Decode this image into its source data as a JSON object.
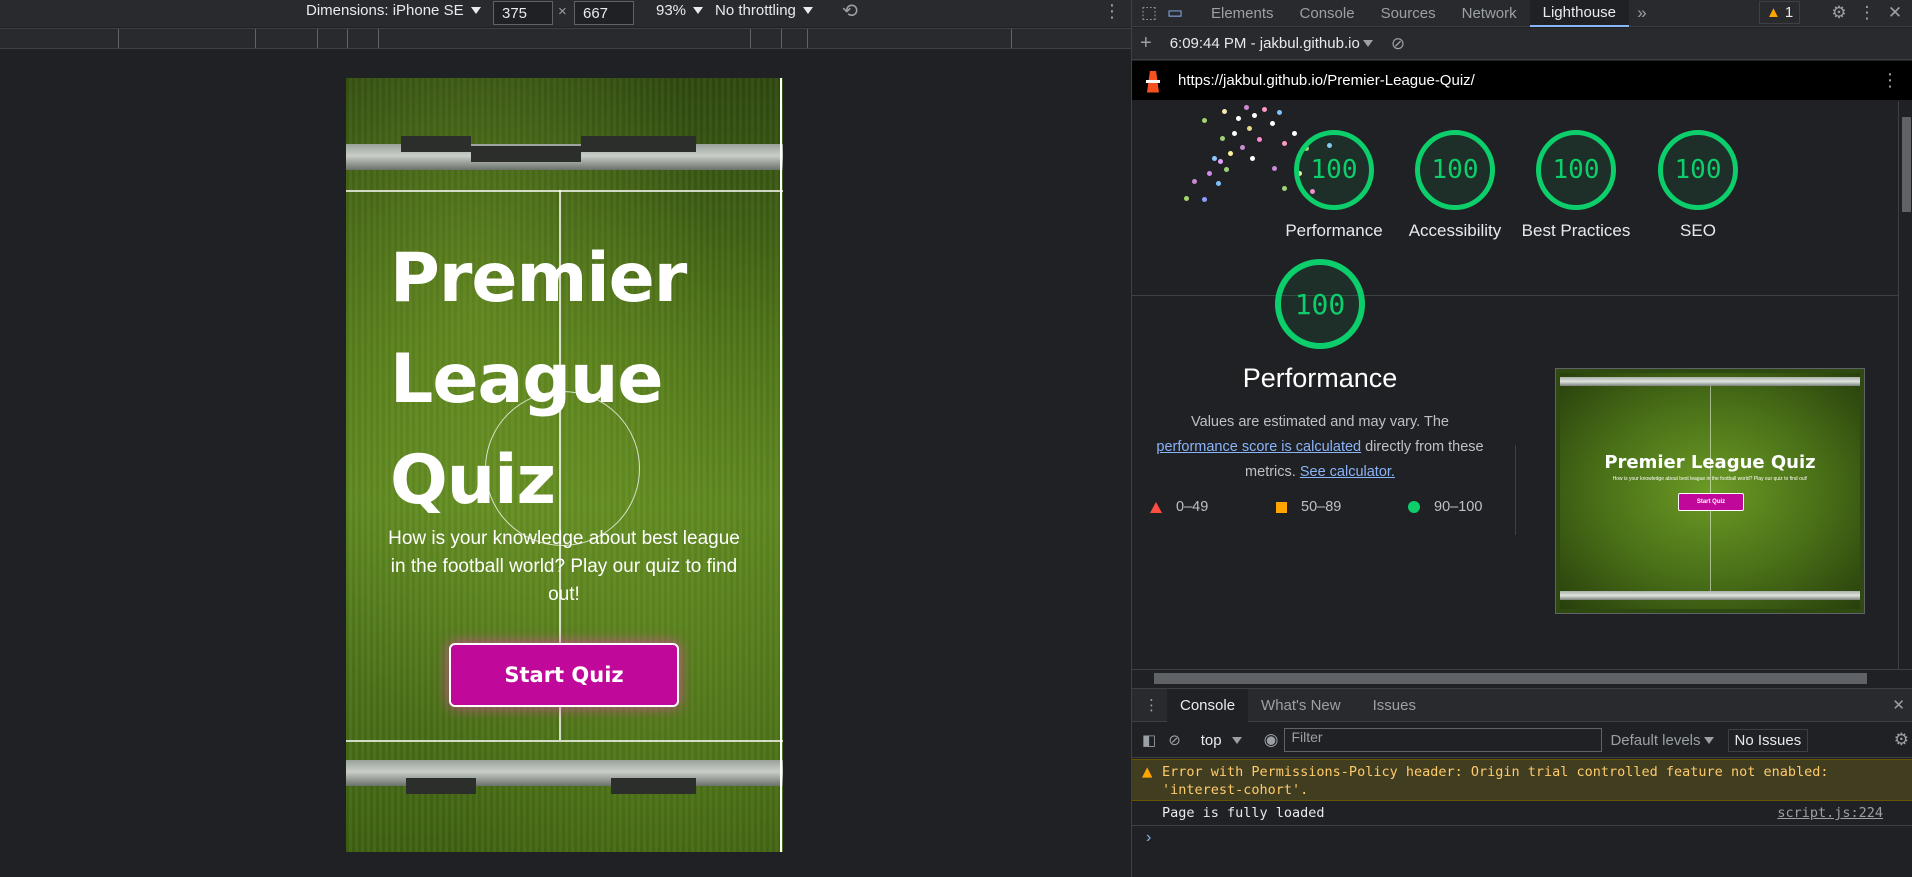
{
  "emulation": {
    "dimensions_label": "Dimensions: iPhone SE",
    "width": "375",
    "height": "667",
    "times": "×",
    "zoom": "93%",
    "throttling": "No throttling"
  },
  "site": {
    "title": "Premier League Quiz",
    "description": "How is your knowledge about best league in the football world? Play our quiz to find out!",
    "button": "Start Quiz"
  },
  "devtools": {
    "tabs": [
      "Elements",
      "Console",
      "Sources",
      "Network",
      "Lighthouse"
    ],
    "active_tab": "Lighthouse",
    "warning_count": "1",
    "report_time": "6:09:44 PM - jakbul.github.io",
    "url": "https://jakbul.github.io/Premier-League-Quiz/"
  },
  "lighthouse": {
    "scores": [
      {
        "label": "Performance",
        "score": "100"
      },
      {
        "label": "Accessibility",
        "score": "100"
      },
      {
        "label": "Best Practices",
        "score": "100"
      },
      {
        "label": "SEO",
        "score": "100"
      }
    ],
    "performance": {
      "score": "100",
      "heading": "Performance",
      "desc_pre": "Values are estimated and may vary. The",
      "desc_link": "performance score is calculated",
      "desc_mid": "directly from these metrics.",
      "desc_calc": "See calculator.",
      "legend": [
        "0–49",
        "50–89",
        "90–100"
      ]
    },
    "thumbnail": {
      "title": "Premier League Quiz",
      "desc": "How is your knowledge about best league in the football world? Play our quiz to find out!",
      "button": "Start Quiz"
    },
    "colors": {
      "pass": "#0cce6b",
      "average": "#ffa400",
      "fail": "#ff4e42"
    }
  },
  "drawer": {
    "tabs": [
      "Console",
      "What's New",
      "Issues"
    ],
    "context": "top",
    "filter_placeholder": "Filter",
    "levels": "Default levels",
    "issues": "No Issues",
    "error_line1": "Error with Permissions-Policy header: Origin trial controlled feature not enabled:",
    "error_line2": "'interest-cohort'.",
    "log": "Page is fully loaded",
    "log_source": "script.js:224",
    "prompt": "›"
  }
}
